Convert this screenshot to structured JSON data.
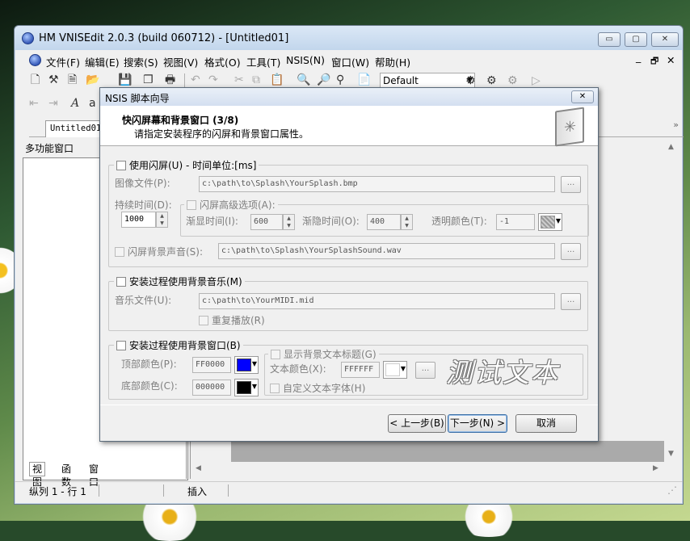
{
  "window": {
    "title": "HM VNISEdit 2.0.3 (build 060712) - [Untitled01]",
    "min": "▭",
    "max": "▢",
    "close": "✕",
    "mdi_min": "_",
    "mdi_restore": "🗗",
    "mdi_close": "✕"
  },
  "menu": [
    "文件(F)",
    "编辑(E)",
    "搜索(S)",
    "视图(V)",
    "格式(O)",
    "工具(T)",
    "NSIS(N)",
    "窗口(W)",
    "帮助(H)"
  ],
  "toolbar": {
    "config": "Default"
  },
  "tabs": {
    "doc": "Untitled01",
    "chevron": "»"
  },
  "panel": {
    "title": "多功能窗口",
    "tabs": [
      "视图",
      "函数",
      "窗口"
    ]
  },
  "status": {
    "position": "纵列 1 - 行 1",
    "mode": "插入"
  },
  "dialog": {
    "title": "NSIS 脚本向导",
    "close": "✕",
    "step_title": "快闪屏幕和背景窗口  (3/8)",
    "step_subtitle": "请指定安装程序的闪屏和背景窗口属性。",
    "splash": {
      "checkbox": "使用闪屏(U) - 时间单位:[ms]",
      "image_label": "图像文件(P):",
      "image_value": "c:\\path\\to\\Splash\\YourSplash.bmp",
      "duration_label": "持续时间(D):",
      "duration_value": "1000",
      "advanced": "闪屏高级选项(A):",
      "fadein_label": "渐显时间(I):",
      "fadein_value": "600",
      "fadeout_label": "渐隐时间(O):",
      "fadeout_value": "400",
      "transparent_label": "透明颜色(T):",
      "transparent_value": "-1",
      "sound_label": "闪屏背景声音(S):",
      "sound_value": "c:\\path\\to\\Splash\\YourSplashSound.wav"
    },
    "music": {
      "checkbox": "安装过程使用背景音乐(M)",
      "file_label": "音乐文件(U):",
      "file_value": "c:\\path\\to\\YourMIDI.mid",
      "repeat": "重复播放(R)"
    },
    "bgwin": {
      "checkbox": "安装过程使用背景窗口(B)",
      "top_label": "顶部颜色(P):",
      "top_value": "FF0000",
      "top_color": "#0000ff",
      "bottom_label": "底部颜色(C):",
      "bottom_value": "000000",
      "bottom_color": "#000000",
      "show_title": "显示背景文本标题(G)",
      "text_color_label": "文本颜色(X):",
      "text_color_value": "FFFFFF",
      "text_color": "#ffffff",
      "custom_font": "自定义文本字体(H)",
      "preview": "测试文本"
    },
    "buttons": {
      "back": "< 上一步(B)",
      "next": "下一步(N) >",
      "cancel": "取消"
    },
    "browse": "..."
  }
}
